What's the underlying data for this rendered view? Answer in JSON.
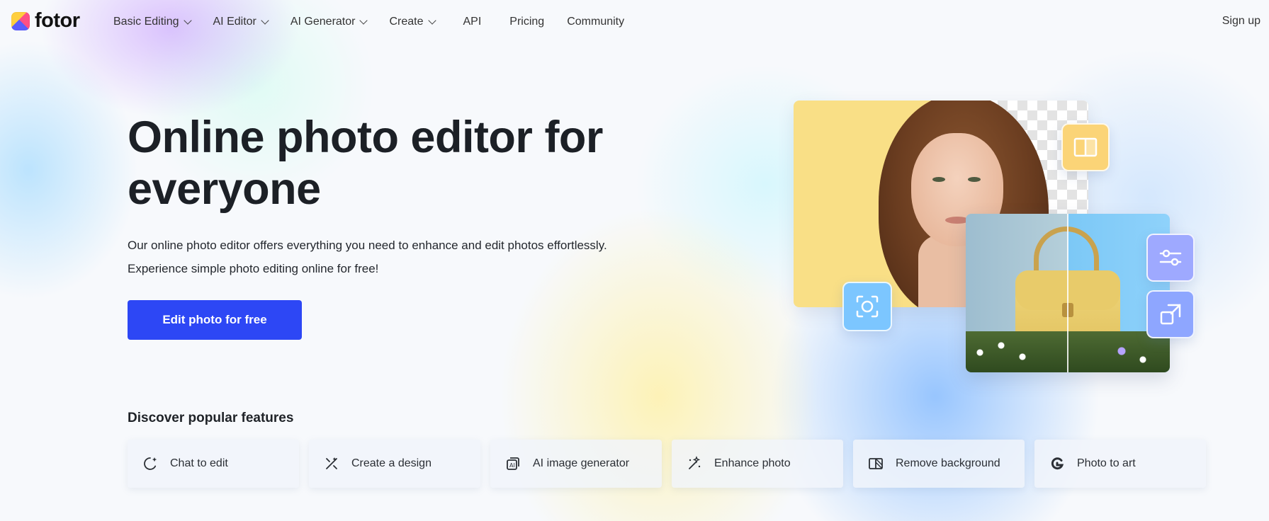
{
  "nav": {
    "logo_text": "fotor",
    "menu": [
      {
        "label": "Basic Editing",
        "dropdown": true
      },
      {
        "label": "AI Editor",
        "dropdown": true
      },
      {
        "label": "AI Generator",
        "dropdown": true
      },
      {
        "label": "Create",
        "dropdown": true
      },
      {
        "label": "API",
        "dropdown": false
      },
      {
        "label": "Pricing",
        "dropdown": false
      },
      {
        "label": "Community",
        "dropdown": false
      }
    ],
    "signup_label": "Sign up"
  },
  "hero": {
    "title": "Online photo editor for everyone",
    "description_line1": "Our online photo editor offers everything you need to enhance and edit photos effortlessly.",
    "description_line2": "Experience simple photo editing online for free!",
    "cta_label": "Edit photo for free",
    "cta_color": "#2d47f5"
  },
  "collage": {
    "tiles": [
      "book-icon",
      "focus-icon",
      "sliders-icon",
      "expand-icon"
    ]
  },
  "features": {
    "title": "Discover popular features",
    "items": [
      {
        "label": "Chat to edit",
        "icon": "chat-sparkle-icon"
      },
      {
        "label": "Create a design",
        "icon": "design-tools-icon"
      },
      {
        "label": "AI image generator",
        "icon": "ai-image-icon"
      },
      {
        "label": "Enhance photo",
        "icon": "magic-wand-icon"
      },
      {
        "label": "Remove background",
        "icon": "remove-background-icon"
      },
      {
        "label": "Photo to art",
        "icon": "photo-to-art-icon"
      }
    ]
  }
}
